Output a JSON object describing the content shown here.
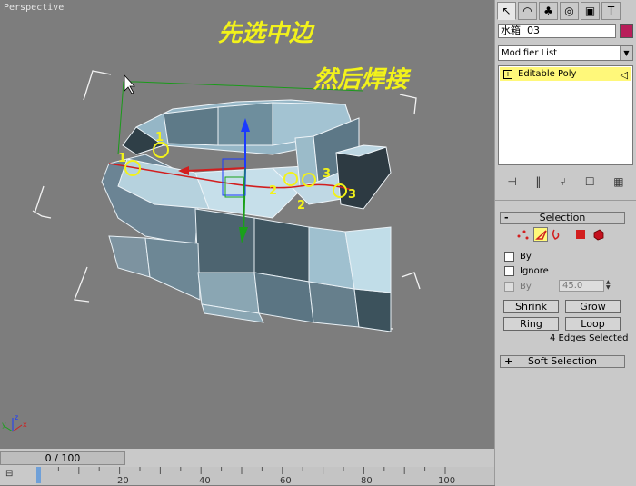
{
  "viewport": {
    "label": "Perspective",
    "annotation_line1": "先选中边",
    "annotation_line2": "然后焊接",
    "markers": [
      "1",
      "1",
      "2",
      "2",
      "3",
      "3"
    ],
    "axis_labels": [
      "x",
      "y",
      "z"
    ]
  },
  "command_panel": {
    "tabs": [
      "create-tab",
      "modify-tab",
      "hierarchy-tab",
      "motion-tab",
      "display-tab",
      "utilities-tab"
    ],
    "object_name": "水箱  03",
    "object_color": "#b81e5a",
    "modifier_list": "Modifier List",
    "stack_item": "Editable Poly",
    "selection_rollout": {
      "title": "Selection",
      "by_vertex": "By",
      "ignore_backfacing": "Ignore",
      "by_angle": "By",
      "angle_value": "45.0",
      "shrink": "Shrink",
      "grow": "Grow",
      "ring": "Ring",
      "loop": "Loop",
      "status": "4 Edges Selected"
    },
    "soft_selection_title": "Soft Selection",
    "accent_yellow": "#fff87a"
  },
  "timeline": {
    "slider_text": "0 / 100",
    "ticks": [
      "20",
      "40",
      "60",
      "80",
      "100"
    ],
    "frame_value": 0
  }
}
